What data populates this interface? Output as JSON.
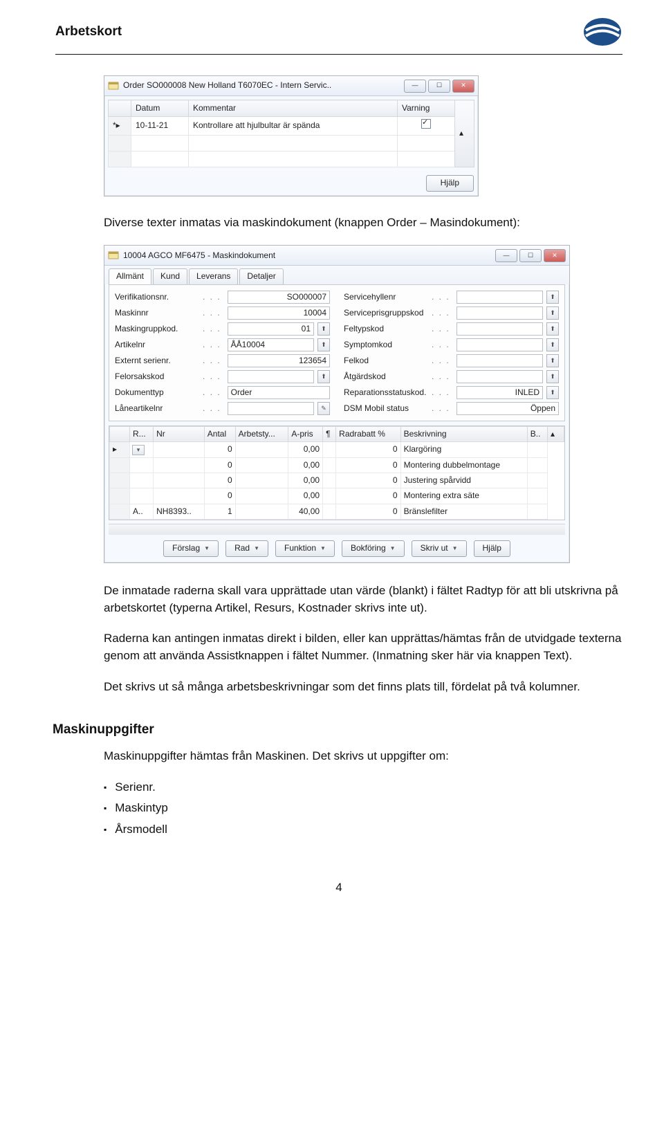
{
  "header": {
    "title": "Arbetskort"
  },
  "win1": {
    "title": "Order SO000008 New Holland T6070EC - Intern Servic..",
    "cols": [
      "Datum",
      "Kommentar",
      "Varning"
    ],
    "rows": [
      {
        "datum": "10-11-21",
        "kommentar": "Kontrollare att hjulbultar är spända",
        "checked": true
      }
    ],
    "help": "Hjälp"
  },
  "para1": "Diverse texter inmatas via maskindokument (knappen Order – Masindokument):",
  "win2": {
    "title": "10004 AGCO MF6475 - Maskindokument",
    "tabs": [
      "Allmänt",
      "Kund",
      "Leverans",
      "Detaljer"
    ],
    "left_fields": [
      {
        "label": "Verifikationsnr.",
        "value": "SO000007",
        "align": "right",
        "assist": false
      },
      {
        "label": "Maskinnr",
        "value": "10004",
        "align": "right",
        "assist": false
      },
      {
        "label": "Maskingruppkod.",
        "value": "01",
        "align": "right",
        "assist": true
      },
      {
        "label": "Artikelnr",
        "value": "ÅÅ10004",
        "align": "left",
        "assist": true
      },
      {
        "label": "Externt serienr.",
        "value": "123654",
        "align": "right",
        "assist": false
      },
      {
        "label": "Felorsakskod",
        "value": "",
        "align": "left",
        "assist": true
      },
      {
        "label": "Dokumenttyp",
        "value": "Order",
        "align": "left",
        "assist": false
      },
      {
        "label": "Låneartikelnr",
        "value": "",
        "align": "left",
        "assist": true,
        "pencil": true
      }
    ],
    "right_fields": [
      {
        "label": "Servicehyllenr",
        "value": "",
        "assist": true
      },
      {
        "label": "Serviceprisgruppskod",
        "value": "",
        "assist": true
      },
      {
        "label": "Feltypskod",
        "value": "",
        "assist": true
      },
      {
        "label": "Symptomkod",
        "value": "",
        "assist": true
      },
      {
        "label": "Felkod",
        "value": "",
        "assist": true
      },
      {
        "label": "Åtgärdskod",
        "value": "",
        "assist": true
      },
      {
        "label": "Reparationsstatuskod.",
        "value": "INLED",
        "assist": true
      },
      {
        "label": "DSM Mobil status",
        "value": "Öppen",
        "assist": false
      }
    ],
    "line_cols": [
      "R...",
      "Nr",
      "Antal",
      "Arbetsty...",
      "A-pris",
      "¶",
      "Radrabatt %",
      "Beskrivning",
      "B.."
    ],
    "lines": [
      {
        "r": "",
        "nr": "",
        "antal": "0",
        "arbetsty": "",
        "apris": "0,00",
        "para": "",
        "radrabatt": "0",
        "beskr": "Klargöring",
        "b": ""
      },
      {
        "r": "",
        "nr": "",
        "antal": "0",
        "arbetsty": "",
        "apris": "0,00",
        "para": "",
        "radrabatt": "0",
        "beskr": "Montering dubbelmontage",
        "b": ""
      },
      {
        "r": "",
        "nr": "",
        "antal": "0",
        "arbetsty": "",
        "apris": "0,00",
        "para": "",
        "radrabatt": "0",
        "beskr": "Justering spårvidd",
        "b": ""
      },
      {
        "r": "",
        "nr": "",
        "antal": "0",
        "arbetsty": "",
        "apris": "0,00",
        "para": "",
        "radrabatt": "0",
        "beskr": "Montering extra säte",
        "b": ""
      },
      {
        "r": "A..",
        "nr": "NH8393..",
        "antal": "1",
        "arbetsty": "",
        "apris": "40,00",
        "para": "",
        "radrabatt": "0",
        "beskr": "Bränslefilter",
        "b": ""
      }
    ],
    "buttons": [
      "Förslag",
      "Rad",
      "Funktion",
      "Bokföring",
      "Skriv ut",
      "Hjälp"
    ]
  },
  "para2": "De inmatade raderna skall vara upprättade utan värde (blankt) i fältet Radtyp för att bli utskrivna på arbetskortet (typerna Artikel, Resurs, Kostnader skrivs inte ut).",
  "para3": "Raderna kan antingen inmatas direkt i bilden, eller kan upprättas/hämtas från de utvidgade texterna genom att använda Assistknappen i fältet Nummer. (Inmatning sker här via knappen Text).",
  "para4": "Det skrivs ut så många arbetsbeskrivningar som det finns plats till, fördelat på två kolumner.",
  "maskin": {
    "title": "Maskinuppgifter",
    "intro": "Maskinuppgifter hämtas från Maskinen. Det skrivs ut uppgifter om:",
    "items": [
      "Serienr.",
      "Maskintyp",
      "Årsmodell"
    ]
  },
  "pagenum": "4"
}
